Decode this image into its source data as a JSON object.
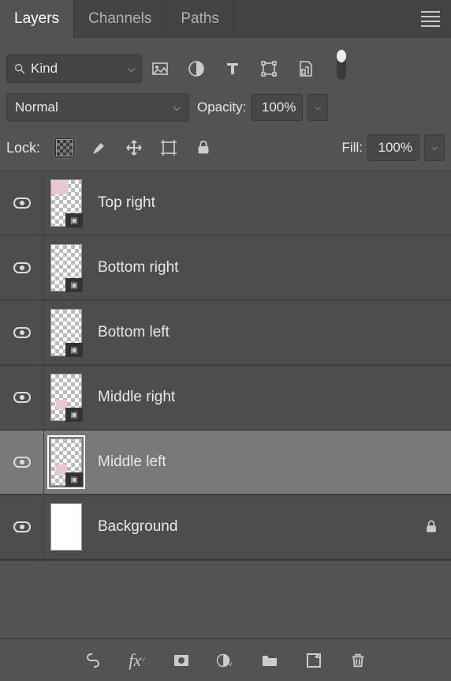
{
  "tabs": [
    "Layers",
    "Channels",
    "Paths"
  ],
  "activeTab": 0,
  "filter": {
    "kind": "Kind"
  },
  "blend": {
    "mode": "Normal",
    "opacityLabel": "Opacity:",
    "opacityValue": "100%"
  },
  "lockRow": {
    "label": "Lock:",
    "fillLabel": "Fill:",
    "fillValue": "100%"
  },
  "layers": [
    {
      "name": "Top right",
      "smart": true,
      "locked": false,
      "selected": false,
      "thumb": "pink"
    },
    {
      "name": "Bottom right",
      "smart": true,
      "locked": false,
      "selected": false,
      "thumb": "checker"
    },
    {
      "name": "Bottom left",
      "smart": true,
      "locked": false,
      "selected": false,
      "thumb": "checker"
    },
    {
      "name": "Middle right",
      "smart": true,
      "locked": false,
      "selected": false,
      "thumb": "pink2"
    },
    {
      "name": "Middle left",
      "smart": true,
      "locked": false,
      "selected": true,
      "thumb": "pink2sel"
    },
    {
      "name": "Background",
      "smart": false,
      "locked": true,
      "selected": false,
      "thumb": "white"
    }
  ]
}
